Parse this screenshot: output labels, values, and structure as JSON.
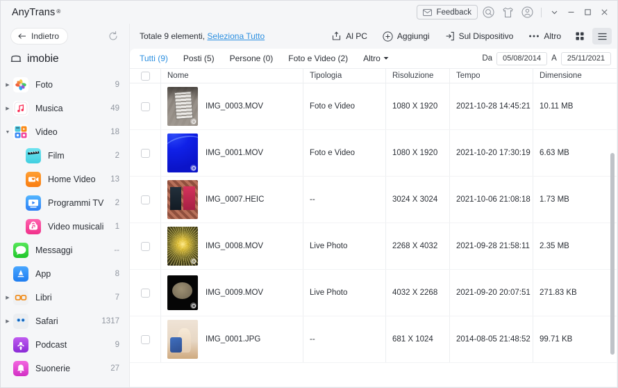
{
  "titlebar": {
    "brand": "AnyTrans",
    "registered": "®",
    "feedback_label": "Feedback",
    "icons": {
      "feedback": "envelope-icon",
      "search": "search-icon",
      "theme": "shirt-icon",
      "account": "account-icon",
      "more": "chevron-down-icon",
      "minimize": "minimize-icon",
      "maximize": "maximize-icon",
      "close": "close-icon"
    }
  },
  "sidebar": {
    "back_label": "Indietro",
    "refresh_label": "refresh-icon",
    "device_name": "imobie",
    "items": [
      {
        "label": "Foto",
        "count": "9",
        "level": 1,
        "arrow": "right",
        "icon": "photos-icon"
      },
      {
        "label": "Musica",
        "count": "49",
        "level": 1,
        "arrow": "right",
        "icon": "music-icon"
      },
      {
        "label": "Video",
        "count": "18",
        "level": 1,
        "arrow": "down",
        "icon": "video-icon"
      },
      {
        "label": "Film",
        "count": "2",
        "level": 2,
        "arrow": "",
        "icon": "film-icon"
      },
      {
        "label": "Home Video",
        "count": "13",
        "level": 2,
        "arrow": "",
        "icon": "home-video-icon"
      },
      {
        "label": "Programmi TV",
        "count": "2",
        "level": 2,
        "arrow": "",
        "icon": "tv-show-icon"
      },
      {
        "label": "Video musicali",
        "count": "1",
        "level": 2,
        "arrow": "",
        "icon": "music-video-icon"
      },
      {
        "label": "Messaggi",
        "count": "--",
        "level": 1,
        "arrow": "",
        "icon": "messages-icon"
      },
      {
        "label": "App",
        "count": "8",
        "level": 1,
        "arrow": "",
        "icon": "appstore-icon"
      },
      {
        "label": "Libri",
        "count": "7",
        "level": 1,
        "arrow": "right",
        "icon": "books-icon"
      },
      {
        "label": "Safari",
        "count": "1317",
        "level": 1,
        "arrow": "right",
        "icon": "safari-icon"
      },
      {
        "label": "Podcast",
        "count": "9",
        "level": 1,
        "arrow": "",
        "icon": "podcast-icon"
      },
      {
        "label": "Suonerie",
        "count": "27",
        "level": 1,
        "arrow": "",
        "icon": "ringtone-icon"
      }
    ]
  },
  "toolbar": {
    "total_prefix": "Totale 9 elementi,",
    "select_all_label": "Seleziona Tutto",
    "to_pc_label": "Al PC",
    "add_label": "Aggiungi",
    "on_device_label": "Sul Dispositivo",
    "more_label": "Altro",
    "grid_view": "grid-view-icon",
    "list_view": "list-view-icon",
    "active_view": "list"
  },
  "filters": {
    "tabs": [
      {
        "label": "Tutti (9)",
        "active": true
      },
      {
        "label": "Posti (5)",
        "active": false
      },
      {
        "label": "Persone (0)",
        "active": false
      },
      {
        "label": "Foto e Video (2)",
        "active": false
      },
      {
        "label": "Altro",
        "active": false,
        "dropdown": true
      }
    ],
    "date_from_label": "Da",
    "date_from_value": "05/08/2014",
    "date_to_label": "A",
    "date_to_value": "25/11/2021"
  },
  "table": {
    "columns": [
      "Nome",
      "Tipologia",
      "Risoluzione",
      "Tempo",
      "Dimensione"
    ],
    "rows": [
      {
        "name": "IMG_0003.MOV",
        "type": "Foto e Video",
        "resolution": "1080 X 1920",
        "time": "2021-10-28 14:45:21",
        "size": "10.11 MB",
        "checked": false,
        "thumb": "th1",
        "has_badge": true
      },
      {
        "name": "IMG_0001.MOV",
        "type": "Foto e Video",
        "resolution": "1080 X 1920",
        "time": "2021-10-20 17:30:19",
        "size": "6.63 MB",
        "checked": false,
        "thumb": "th2",
        "has_badge": true
      },
      {
        "name": "IMG_0007.HEIC",
        "type": "--",
        "resolution": "3024 X 3024",
        "time": "2021-10-06 21:08:18",
        "size": "1.73 MB",
        "checked": false,
        "thumb": "th3",
        "has_badge": false
      },
      {
        "name": "IMG_0008.MOV",
        "type": "Live Photo",
        "resolution": "2268 X 4032",
        "time": "2021-09-28 21:58:11",
        "size": "2.35 MB",
        "checked": false,
        "thumb": "th4",
        "has_badge": true
      },
      {
        "name": "IMG_0009.MOV",
        "type": "Live Photo",
        "resolution": "4032 X 2268",
        "time": "2021-09-20 20:07:51",
        "size": "271.83 KB",
        "checked": false,
        "thumb": "th5",
        "has_badge": true
      },
      {
        "name": "IMG_0001.JPG",
        "type": "--",
        "resolution": "681 X 1024",
        "time": "2014-08-05 21:48:52",
        "size": "99.71 KB",
        "checked": false,
        "thumb": "th6",
        "has_badge": false
      }
    ]
  },
  "colors": {
    "accent": "#2b8fe0",
    "chrome": "#f5f6f8",
    "panel": "#ffffff",
    "text": "#2a2e35",
    "muted": "#9096a0"
  }
}
